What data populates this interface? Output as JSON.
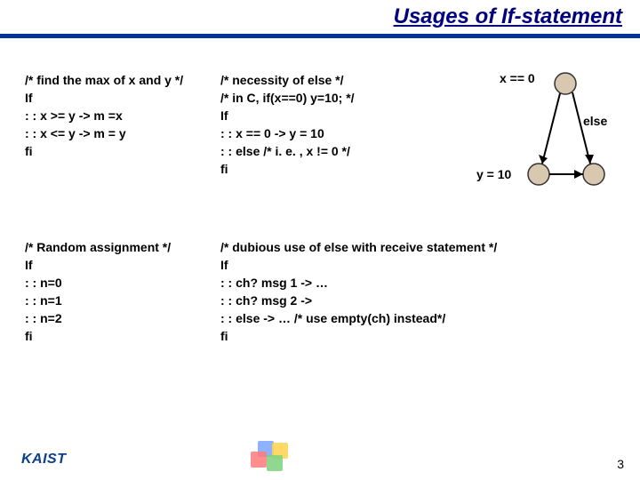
{
  "title": "Usages of If-statement",
  "blocks": {
    "max": "/* find the max of x and y */\nIf\n: : x >= y -> m =x\n: : x <= y -> m = y\nfi",
    "necessity": "/* necessity of else */\n/* in C, if(x==0) y=10; */\nIf\n: : x == 0 -> y = 10\n: : else /* i. e. , x != 0 */\nfi",
    "random": "/* Random assignment */\nIf\n: : n=0\n: : n=1\n: : n=2\nfi",
    "dubious": "/* dubious use of else with receive statement */\nIf\n: : ch? msg 1 -> …\n: : ch? msg 2 ->\n: : else -> … /* use empty(ch) instead*/\nfi"
  },
  "diagram": {
    "x_eq_0": "x == 0",
    "else_label": "else",
    "y_10": "y = 10"
  },
  "footer": {
    "logo": "KAIST",
    "page": "3"
  }
}
